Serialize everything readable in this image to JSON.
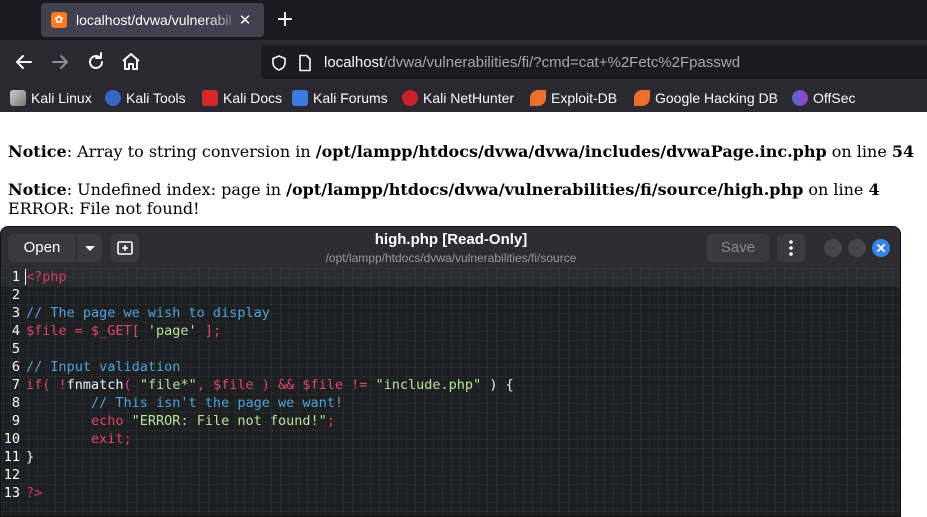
{
  "browser": {
    "tab_title": "localhost/dvwa/vulnerabil",
    "url_host": "localhost",
    "url_rest": "/dvwa/vulnerabilities/fi/?cmd=cat+%2Fetc%2Fpasswd",
    "bookmarks": [
      {
        "label": "Kali Linux",
        "icon": "kali-dragon-icon"
      },
      {
        "label": "Kali Tools",
        "icon": "kali-tools-icon"
      },
      {
        "label": "Kali Docs",
        "icon": "kali-docs-icon"
      },
      {
        "label": "Kali Forums",
        "icon": "kali-forums-icon"
      },
      {
        "label": "Kali NetHunter",
        "icon": "kali-nethunter-icon"
      },
      {
        "label": "Exploit-DB",
        "icon": "exploit-db-icon"
      },
      {
        "label": "Google Hacking DB",
        "icon": "ghdb-icon"
      },
      {
        "label": "OffSec",
        "icon": "offsec-icon"
      }
    ]
  },
  "page": {
    "notice1": {
      "label": "Notice",
      "text": ": Array to string conversion in ",
      "path": "/opt/lampp/htdocs/dvwa/dvwa/includes/dvwaPage.inc.php",
      "online": " on line ",
      "line": "54"
    },
    "notice2": {
      "label": "Notice",
      "text": ": Undefined index: page in ",
      "path": "/opt/lampp/htdocs/dvwa/vulnerabilities/fi/source/high.php",
      "online": " on line ",
      "line": "4"
    },
    "error": "ERROR: File not found!"
  },
  "editor": {
    "open_label": "Open",
    "title": "high.php [Read-Only]",
    "subtitle": "/opt/lampp/htdocs/dvwa/vulnerabilities/fi/source",
    "save_label": "Save",
    "lines": {
      "l1": {
        "n": "1",
        "a": "<?php"
      },
      "l2": {
        "n": "2"
      },
      "l3": {
        "n": "3",
        "a": "// The page we wish to display"
      },
      "l4": {
        "n": "4",
        "a": "$file = $_GET[ ",
        "b": "'page'",
        "c": " ];"
      },
      "l5": {
        "n": "5"
      },
      "l6": {
        "n": "6",
        "a": "// Input validation"
      },
      "l7": {
        "n": "7",
        "a": "if( !",
        "b": "fnmatch",
        "c": "( ",
        "d": "\"file*\"",
        "e": ", $file ) && $file != ",
        "f": "\"include.php\"",
        "g": " ) {"
      },
      "l8": {
        "n": "8",
        "a": "        // This isn't the page we want!"
      },
      "l9": {
        "n": "9",
        "a": "        echo ",
        "b": "\"ERROR: File not found!\"",
        "c": ";"
      },
      "l10": {
        "n": "10",
        "a": "        exit;"
      },
      "l11": {
        "n": "11",
        "a": "}"
      },
      "l12": {
        "n": "12"
      },
      "l13": {
        "n": "13",
        "a": "?>"
      }
    }
  },
  "colors": {
    "accent": "#3584e4",
    "php_keyword": "#e0476e",
    "comment": "#4fa3e0",
    "string": "#b6e3a0"
  }
}
